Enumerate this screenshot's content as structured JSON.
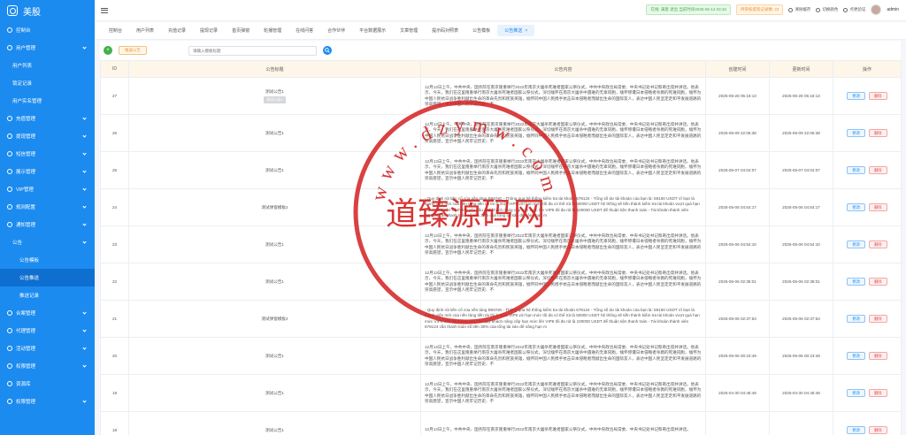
{
  "app": {
    "title": "美股"
  },
  "sidebar": {
    "items": [
      {
        "label": "控制台",
        "level": 0,
        "chev": false
      },
      {
        "label": "用户管理",
        "level": 0,
        "chev": true
      },
      {
        "label": "用户列表",
        "level": 1,
        "chev": false
      },
      {
        "label": "锁定记录",
        "level": 1,
        "chev": false
      },
      {
        "label": "用户实名管理",
        "level": 1,
        "chev": false
      },
      {
        "label": "充值管理",
        "level": 0,
        "chev": true
      },
      {
        "label": "提现管理",
        "level": 0,
        "chev": true
      },
      {
        "label": "短信管理",
        "level": 0,
        "chev": true
      },
      {
        "label": "展示管理",
        "level": 0,
        "chev": true
      },
      {
        "label": "VIP管理",
        "level": 0,
        "chev": true
      },
      {
        "label": "规则配置",
        "level": 0,
        "chev": true
      },
      {
        "label": "通知管理",
        "level": 0,
        "chev": true
      },
      {
        "label": "公告",
        "level": 1,
        "chev": true
      },
      {
        "label": "公告模板",
        "level": 2,
        "chev": false
      },
      {
        "label": "公告推送",
        "level": 2,
        "chev": false,
        "active": true
      },
      {
        "label": "推送记录",
        "level": 2,
        "chev": false
      },
      {
        "label": "合案管理",
        "level": 0,
        "chev": true
      },
      {
        "label": "代理管理",
        "level": 0,
        "chev": true
      },
      {
        "label": "活动管理",
        "level": 0,
        "chev": true
      },
      {
        "label": "权限管理",
        "level": 0,
        "chev": true
      },
      {
        "label": "资源库",
        "level": 0,
        "chev": false
      },
      {
        "label": "权限管理",
        "level": 0,
        "chev": true
      }
    ]
  },
  "header": {
    "status_tag": "在线: 满意 退出 当前时间2025-05-14 03:15",
    "info_tag": "待审核提现记录数: 23",
    "clear_cache": "清除缓存",
    "switch_color": "切换颜色",
    "exit": "点更验证",
    "user": "admin"
  },
  "tabs": [
    {
      "label": "控制台"
    },
    {
      "label": "用户列表"
    },
    {
      "label": "充值记录"
    },
    {
      "label": "提现记录"
    },
    {
      "label": "首页弹窗"
    },
    {
      "label": "轮播管理"
    },
    {
      "label": "在线问答"
    },
    {
      "label": "合作伙伴"
    },
    {
      "label": "平台数据展示"
    },
    {
      "label": "文章管理"
    },
    {
      "label": "提示码对照表"
    },
    {
      "label": "公告模板"
    },
    {
      "label": "公告推送",
      "active": true,
      "close": "×"
    }
  ],
  "toolbar": {
    "add": "+",
    "publish": "推送公告",
    "search_placeholder": "请输入模板标题",
    "search_icon": "search-icon"
  },
  "table": {
    "columns": [
      "ID",
      "公告标题",
      "公告内容",
      "创建时间",
      "更新时间",
      "操作"
    ],
    "edit_label": "修改",
    "delete_label": "删除",
    "tooltip": "测试公告1",
    "rows": [
      {
        "id": "27",
        "title": "测试公告1",
        "content": "12月13日上午，中共中央、国务院在南京隆重举行2022年南京大屠杀死难者国家公祭仪式。中共中央政治局常委、中央书记处书记蔡奇出席并讲话。他表示，今天，我们在这里隆重举行南京大屠杀死难者国家公祭仪式，深切缅怀在南京大屠杀中遇难的无辜同胞，缅怀惨遭日本侵略者杀戮的死难同胞，缅怀为中国人民抗日战争胜利献出生命的革命先烈和民族英雄，缅怀同中国人民携手抗击日本侵略者而献出生命的国际友人，表达中国人民坚定走和平发展道路的崇高愿望，宣示中国人民牢记历史、不",
        "created": "2025-05-28 05:18:13",
        "updated": "2025-05-28 05:18:13",
        "tooltip": true
      },
      {
        "id": "26",
        "title": "测试公告1",
        "content": "12月13日上午，中共中央、国务院在南京隆重举行2022年南京大屠杀死难者国家公祭仪式。中共中央政治局常委、中央书记处书记蔡奇出席并讲话。他表示，今天，我们在这里隆重举行南京大屠杀死难者国家公祭仪式，深切缅怀在南京大屠杀中遇难的无辜同胞，缅怀惨遭日本侵略者杀戮的死难同胞，缅怀为中国人民抗日战争胜利献出生命的革命先烈和民族英雄，缅怀同中国人民携手抗击日本侵略者而献出生命的国际友人，表达中国人民坚定走和平发展道路的崇高愿望，宣示中国人民牢记历史、不",
        "created": "2025-05-09 22:06:38",
        "updated": "2025-05-09 22:06:38"
      },
      {
        "id": "25",
        "title": "测试公告1",
        "content": "12月13日上午，中共中央、国务院在南京隆重举行2022年南京大屠杀死难者国家公祭仪式。中共中央政治局常委、中央书记处书记蔡奇出席并讲话。他表示，今天，我们在这里隆重举行南京大屠杀死难者国家公祭仪式，深切缅怀在南京大屠杀中遇难的无辜同胞，缅怀惨遭日本侵略者杀戮的死难同胞，缅怀为中国人民抗日战争胜利献出生命的革命先烈和民族英雄，缅怀同中国人民携手抗击日本侵略者而献出生命的国际友人，表达中国人民坚定走和平发展道路的崇高愿望，宣示中国人民牢记历史、不",
        "created": "2025-05-07 04:04:07",
        "updated": "2025-05-07 04:04:07"
      },
      {
        "id": "24",
        "title": "测试弹窗模板2",
        "content": "- Quy định rút tiền cổ của nền tảng BIKING - Thông qua hệ thống kiểm tra tài khoản 678124 - Tổng số dư tài khoản của bạn là: 59150 USDT Vì bạn là thành viên mới của nền tảng tiền tài thi ở mức VIP5 với hạn mức tối đa có thể rút là 50000 USDT hệ thống sẽ tiến thành kiểm tra tài khoản vượt quá hạn mức VIP5 nên hệ thống yêu cầu quý khách nâng cấp hạn mức lên VIP6 tối đa rút là 100000 USDT để thuận tiện thanh toán - Tài khoản thành viên 678124 cần thanh toán số tiền 30% của tổng tài sản để nâng hạn m",
        "created": "2025-05-06 04:54:17",
        "updated": "2025-05-06 04:54:17"
      },
      {
        "id": "23",
        "title": "测试公告1",
        "content": "12月13日上午，中共中央、国务院在南京隆重举行2022年南京大屠杀死难者国家公祭仪式。中共中央政治局常委、中央书记处书记蔡奇出席并讲话。他表示，今天，我们在这里隆重举行南京大屠杀死难者国家公祭仪式，深切缅怀在南京大屠杀中遇难的无辜同胞，缅怀惨遭日本侵略者杀戮的死难同胞，缅怀为中国人民抗日战争胜利献出生命的革命先烈和民族英雄，缅怀同中国人民携手抗击日本侵略者而献出生命的国际友人，表达中国人民坚定走和平发展道路的崇高愿望，宣示中国人民牢记历史、不",
        "created": "2025-05-06 04:54:10",
        "updated": "2025-05-06 04:54:10"
      },
      {
        "id": "22",
        "title": "测试公告1",
        "content": "12月13日上午，中共中央、国务院在南京隆重举行2022年南京大屠杀死难者国家公祭仪式。中共中央政治局常委、中央书记处书记蔡奇出席并讲话。他表示，今天，我们在这里隆重举行南京大屠杀死难者国家公祭仪式，深切缅怀在南京大屠杀中遇难的无辜同胞，缅怀惨遭日本侵略者杀戮的死难同胞，缅怀为中国人民抗日战争胜利献出生命的革命先烈和民族英雄，缅怀同中国人民携手抗击日本侵略者而献出生命的国际友人，表达中国人民坚定走和平发展道路的崇高愿望，宣示中国人民牢记历史、不",
        "created": "2025-05-06 02:38:01",
        "updated": "2025-05-06 02:38:01"
      },
      {
        "id": "21",
        "title": "测试弹窗模板2",
        "content": "- Quy định rút tiền cổ của nền tảng BIKING - Thông qua hệ thống kiểm tra tài khoản 678124 - Tổng số dư tài khoản của bạn là: 59150 USDT Vì bạn là thành viên mới của nền tảng tiền tài thi ở mức VIP5 với hạn mức tối đa có thể rút là 50000 USDT hệ thống sẽ tiến thành kiểm tra tài khoản vượt quá hạn mức VIP5 nên hệ thống yêu cầu quý khách nâng cấp hạn mức lên VIP6 tối đa rút là 100000 USDT để thuận tiện thanh toán - Tài khoản thành viên 678124 cần thanh toán số tiền 30% của tổng tài sản để nâng hạn m",
        "created": "2025-05-06 02:37:53",
        "updated": "2025-05-06 02:37:53"
      },
      {
        "id": "20",
        "title": "测试公告1",
        "content": "12月13日上午，中共中央、国务院在南京隆重举行2022年南京大屠杀死难者国家公祭仪式。中共中央政治局常委、中央书记处书记蔡奇出席并讲话。他表示，今天，我们在这里隆重举行南京大屠杀死难者国家公祭仪式，深切缅怀在南京大屠杀中遇难的无辜同胞，缅怀惨遭日本侵略者杀戮的死难同胞，缅怀为中国人民抗日战争胜利献出生命的革命先烈和民族英雄，缅怀同中国人民携手抗击日本侵略者而献出生命的国际友人，表达中国人民坚定走和平发展道路的崇高愿望，宣示中国人民牢记历史、不",
        "created": "2025-05-06 00:23:49",
        "updated": "2025-05-06 00:23:49"
      },
      {
        "id": "19",
        "title": "测试公告1",
        "content": "12月13日上午，中共中央、国务院在南京隆重举行2022年南京大屠杀死难者国家公祭仪式。中共中央政治局常委、中央书记处书记蔡奇出席并讲话。他表示，今天，我们在这里隆重举行南京大屠杀死难者国家公祭仪式，深切缅怀在南京大屠杀中遇难的无辜同胞，缅怀惨遭日本侵略者杀戮的死难同胞，缅怀为中国人民抗日战争胜利献出生命的革命先烈和民族英雄，缅怀同中国人民携手抗击日本侵略者而献出生命的国际友人，表达中国人民坚定走和平发展道路的崇高愿望，宣示中国人民牢记历史、不",
        "created": "2025-04-30 04:46:48",
        "updated": "2025-04-30 04:46:48"
      },
      {
        "id": "18",
        "title": "测试公告1",
        "content": "12月13日上午，中共中央、国务院在南京隆重举行2022年南京大屠杀死难者国家公祭仪式。中共中央政治局常委、中央书记处书记蔡奇出席并讲话。",
        "created": "",
        "updated": ""
      }
    ]
  },
  "watermark": {
    "text": "道臻源码网",
    "ring_text": "www.dzymw.com"
  }
}
